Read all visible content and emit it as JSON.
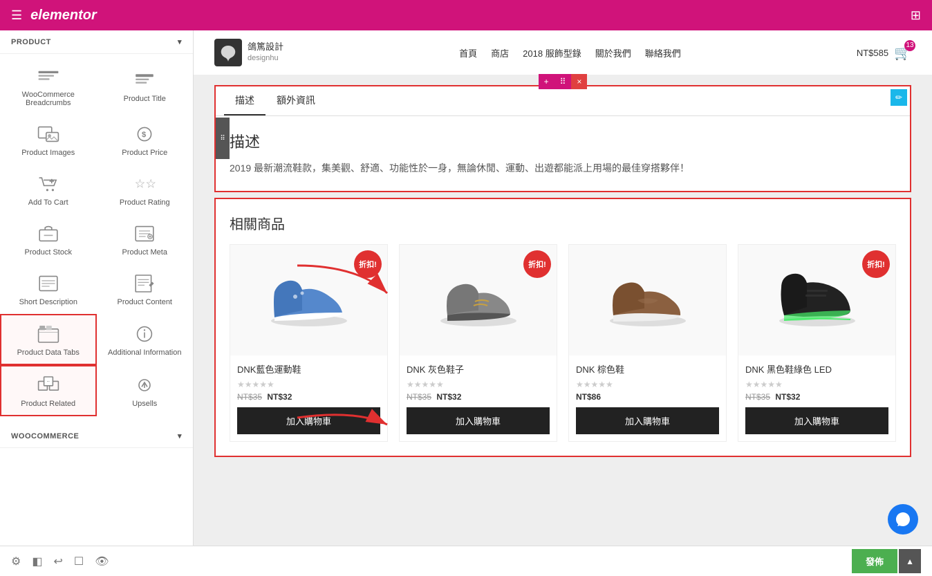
{
  "topbar": {
    "logo": "elementor",
    "menu_icon": "☰",
    "grid_icon": "⊞"
  },
  "sidebar": {
    "product_section_label": "PRODUCT",
    "widgets": [
      {
        "id": "woocommerce-breadcrumbs",
        "label": "WooCommerce Breadcrumbs",
        "icon": "breadcrumbs"
      },
      {
        "id": "product-title",
        "label": "Product Title",
        "icon": "title"
      },
      {
        "id": "product-images",
        "label": "Product Images",
        "icon": "images"
      },
      {
        "id": "product-price",
        "label": "Product Price",
        "icon": "price"
      },
      {
        "id": "add-to-cart",
        "label": "Add To Cart",
        "icon": "cart"
      },
      {
        "id": "product-rating",
        "label": "Product Rating",
        "icon": "rating"
      },
      {
        "id": "product-stock",
        "label": "Product Stock",
        "icon": "stock"
      },
      {
        "id": "product-meta",
        "label": "Product Meta",
        "icon": "meta"
      },
      {
        "id": "short-description",
        "label": "Short Description",
        "icon": "description"
      },
      {
        "id": "product-content",
        "label": "Product Content",
        "icon": "content"
      },
      {
        "id": "product-data-tabs",
        "label": "Product Data Tabs",
        "icon": "tabs",
        "highlighted": true
      },
      {
        "id": "additional-information",
        "label": "Additional Information",
        "icon": "info"
      },
      {
        "id": "product-related",
        "label": "Product Related",
        "icon": "related",
        "highlighted": true
      },
      {
        "id": "upsells",
        "label": "Upsells",
        "icon": "upsells"
      }
    ],
    "woocommerce_section_label": "WOOCOMMERCE"
  },
  "store_header": {
    "logo_text_line1": "鴿篤設計",
    "logo_text_line2": "designhu",
    "nav_items": [
      "首頁",
      "商店",
      "2018 服飾型錄",
      "關於我們",
      "聯絡我們"
    ],
    "cart_amount": "NT$585",
    "cart_count": "13"
  },
  "toolbar": {
    "add_icon": "+",
    "move_icon": "⠿",
    "close_icon": "×"
  },
  "content_section": {
    "tabs": [
      {
        "label": "描述",
        "active": true
      },
      {
        "label": "額外資訊",
        "active": false
      }
    ],
    "title": "描述",
    "body_text": "2019 最新潮流鞋款，集美觀、舒適、功能性於一身，無論休閒、運動、出遊都能派上用場的最佳穿搭夥伴！"
  },
  "related_section": {
    "title": "相關商品",
    "products": [
      {
        "name": "DNK藍色運動鞋",
        "original_price": "NT$35",
        "current_price": "NT$32",
        "has_discount": true,
        "discount_label": "折扣!",
        "color": "#4a7fb5"
      },
      {
        "name": "DNK 灰色鞋子",
        "original_price": "NT$35",
        "current_price": "NT$32",
        "has_discount": true,
        "discount_label": "折扣!",
        "color": "#888"
      },
      {
        "name": "DNK 棕色鞋",
        "original_price": null,
        "current_price": "NT$86",
        "has_discount": false,
        "discount_label": "",
        "color": "#7a5c3a"
      },
      {
        "name": "DNK 黑色鞋綠色 LED",
        "original_price": "NT$35",
        "current_price": "NT$32",
        "has_discount": true,
        "discount_label": "折扣!",
        "color": "#222"
      }
    ],
    "add_to_cart_label": "加入購物車"
  },
  "bottombar": {
    "publish_label": "發佈"
  }
}
